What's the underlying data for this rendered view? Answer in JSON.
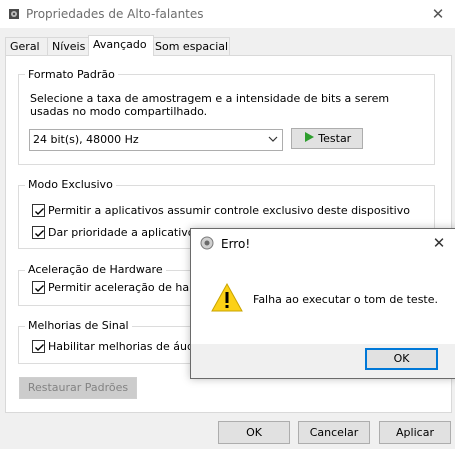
{
  "window": {
    "title": "Propriedades de Alto-falantes",
    "close_label": "✕"
  },
  "tabs": [
    {
      "label": "Geral"
    },
    {
      "label": "Níveis"
    },
    {
      "label": "Avançado"
    },
    {
      "label": "Som espacial"
    }
  ],
  "default_format": {
    "legend": "Formato Padrão",
    "description_line1": "Selecione a taxa de amostragem e a intensidade de bits a serem",
    "description_line2": "usadas no modo compartilhado.",
    "selected_format": "24 bit(s), 48000 Hz",
    "test_button": "Testar"
  },
  "exclusive_mode": {
    "legend": "Modo Exclusivo",
    "option1": "Permitir a aplicativos assumir controle exclusivo deste dispositivo",
    "option1_checked": true,
    "option2": "Dar prioridade a aplicativos",
    "option2_checked": true
  },
  "hardware_accel": {
    "legend": "Aceleração de Hardware",
    "option1": "Permitir aceleração de hardw",
    "option1_checked": true
  },
  "signal_enhancements": {
    "legend": "Melhorias de Sinal",
    "option1": "Habilitar melhorias de áudio",
    "option1_checked": true
  },
  "restore_defaults_button": "Restaurar Padrões",
  "footer": {
    "ok": "OK",
    "cancel": "Cancelar",
    "apply": "Aplicar"
  },
  "error_dialog": {
    "title": "Erro!",
    "close_label": "✕",
    "message": "Falha ao executar o tom de teste.",
    "ok": "OK"
  },
  "colors": {
    "accent": "#0078d7",
    "warning_icon": "#fcd116",
    "play_icon": "#2e9e2e"
  }
}
